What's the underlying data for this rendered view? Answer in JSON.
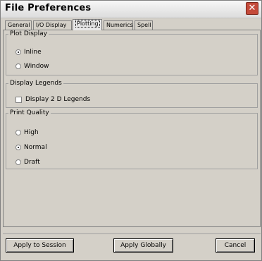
{
  "window": {
    "title": "File Preferences",
    "close_symbol": "✕"
  },
  "tabs": [
    {
      "label": "General"
    },
    {
      "label": "I/O Display"
    },
    {
      "label": "Plotting"
    },
    {
      "label": "Numerics"
    },
    {
      "label": "Spell"
    }
  ],
  "plot_display": {
    "legend": "Plot Display",
    "options": [
      {
        "label": "Inline",
        "selected": true
      },
      {
        "label": "Window",
        "selected": false
      }
    ]
  },
  "display_legends": {
    "legend": "Display Legends",
    "checkbox_label": "Display 2 D Legends",
    "checked": false
  },
  "print_quality": {
    "legend": "Print Quality",
    "options": [
      {
        "label": "High",
        "selected": false
      },
      {
        "label": "Normal",
        "selected": true
      },
      {
        "label": "Draft",
        "selected": false
      }
    ]
  },
  "buttons": {
    "apply_session": "Apply to Session",
    "apply_globally": "Apply Globally",
    "cancel": "Cancel"
  }
}
